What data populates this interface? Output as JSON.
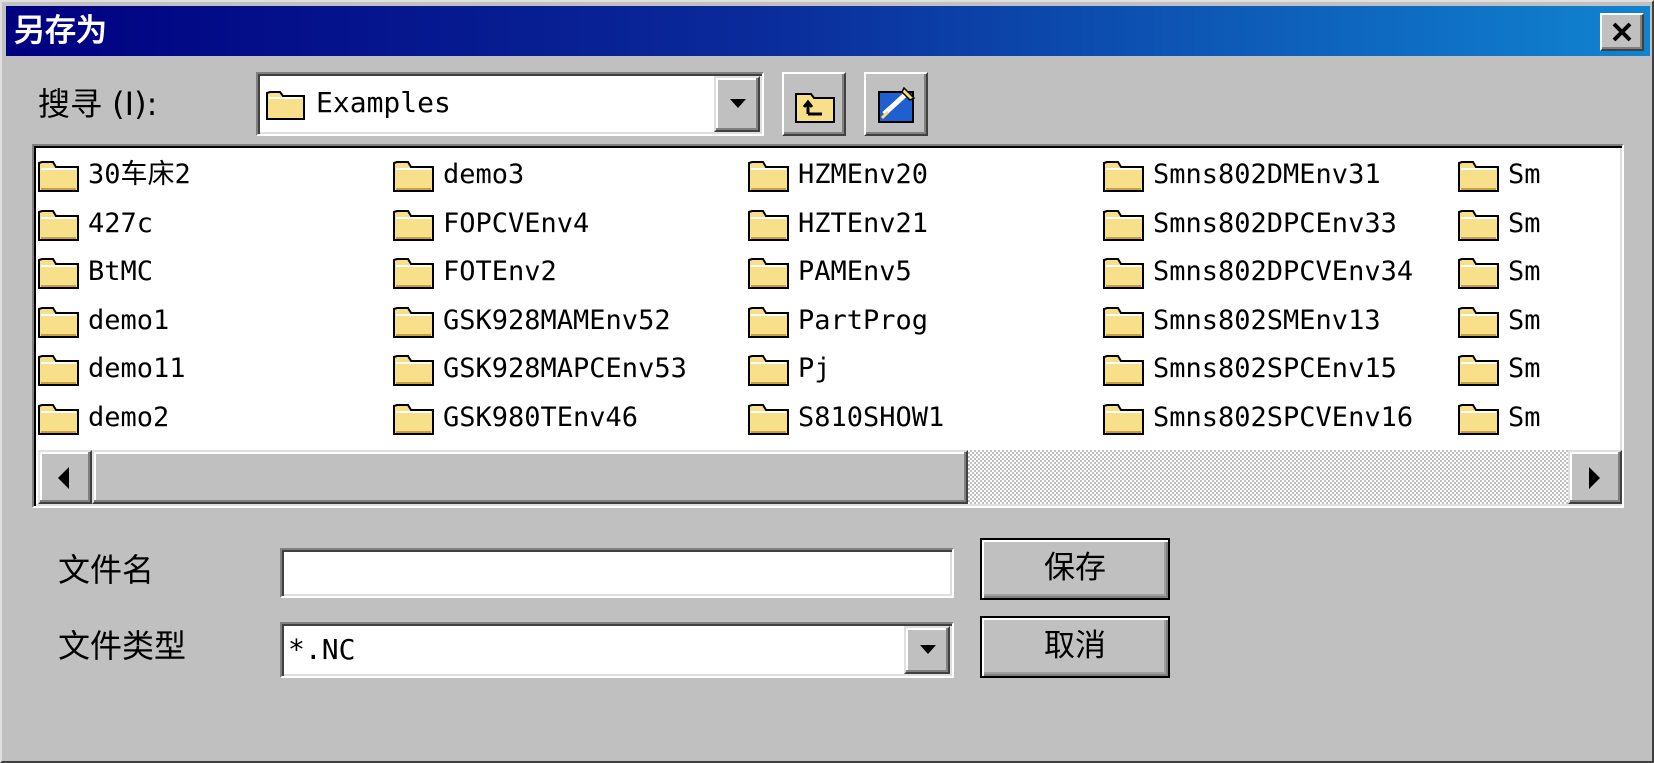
{
  "window": {
    "title": "另存为",
    "close_glyph": "✕"
  },
  "lookin": {
    "label": "搜寻 (I):",
    "value": "Examples",
    "folder_icon": "folder-icon",
    "up_button_icon": "up-one-level-icon",
    "new_folder_button_icon": "create-new-folder-icon"
  },
  "files": {
    "columns": [
      [
        "30车床2",
        "427c",
        "BtMC",
        "demo1",
        "demo11",
        "demo2"
      ],
      [
        "demo3",
        "FOPCVEnv4",
        "FOTEnv2",
        "GSK928MAMEnv52",
        "GSK928MAPCEnv53",
        "GSK980TEnv46"
      ],
      [
        "HZMEnv20",
        "HZTEnv21",
        "PAMEnv5",
        "PartProg",
        "Pj",
        "S810SHOW1"
      ],
      [
        "Smns802DMEnv31",
        "Smns802DPCEnv33",
        "Smns802DPCVEnv34",
        "Smns802SMEnv13",
        "Smns802SPCEnv15",
        "Smns802SPCVEnv16"
      ],
      [
        "Sm",
        "Sm",
        "Sm",
        "Sm",
        "Sm",
        "Sm"
      ]
    ],
    "scroll_position": 0.0
  },
  "filename": {
    "label": "文件名",
    "value": ""
  },
  "filetype": {
    "label": "文件类型",
    "value": "*.NC"
  },
  "buttons": {
    "save": "保存",
    "cancel": "取消"
  },
  "colors": {
    "titlebar_start": "#000080",
    "titlebar_end": "#1084d0",
    "face": "#c0c0c0",
    "folder": "#f8e08a"
  }
}
